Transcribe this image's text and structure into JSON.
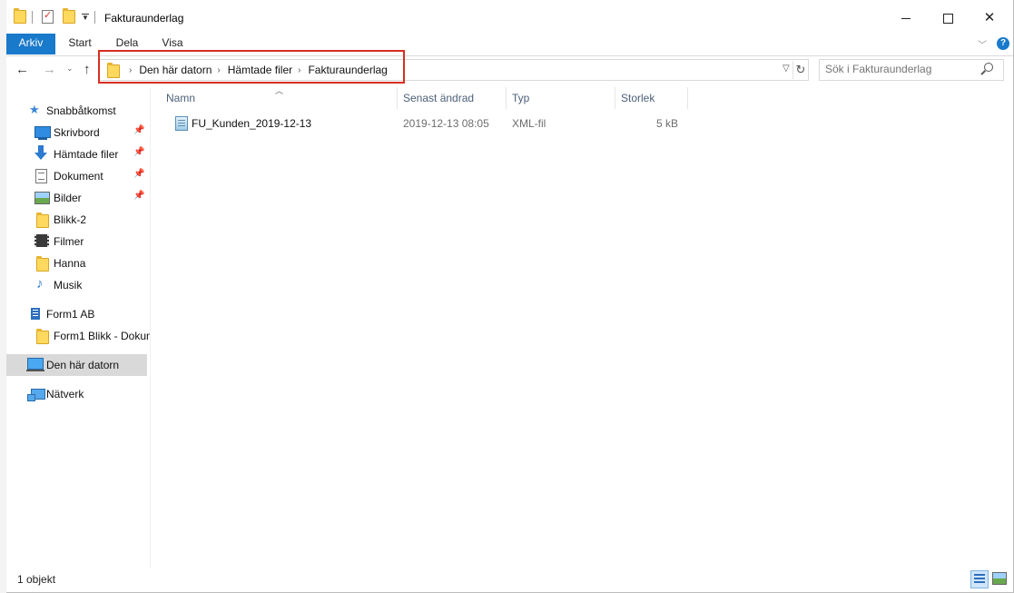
{
  "window": {
    "title": "Fakturaunderlag",
    "controls": {
      "minimize": "minimize-icon",
      "maximize": "maximize-icon",
      "close": "close-icon"
    }
  },
  "ribbon": {
    "tabs": [
      {
        "label": "Arkiv",
        "active": true
      },
      {
        "label": "Start"
      },
      {
        "label": "Dela"
      },
      {
        "label": "Visa"
      }
    ],
    "accent_color": "#1979ca"
  },
  "address": {
    "crumbs": [
      "Den här datorn",
      "Hämtade filer",
      "Fakturaunderlag"
    ],
    "highlight_color": "#d62f22"
  },
  "search": {
    "placeholder": "Sök i Fakturaunderlag"
  },
  "sidebar": {
    "items": [
      {
        "label": "Snabbåtkomst",
        "icon": "star-icon"
      },
      {
        "label": "Skrivbord",
        "icon": "desktop-icon",
        "pinned": true
      },
      {
        "label": "Hämtade filer",
        "icon": "download-icon",
        "pinned": true
      },
      {
        "label": "Dokument",
        "icon": "document-icon",
        "pinned": true
      },
      {
        "label": "Bilder",
        "icon": "pictures-icon",
        "pinned": true
      },
      {
        "label": "Blikk-2",
        "icon": "folder-icon"
      },
      {
        "label": "Filmer",
        "icon": "film-icon"
      },
      {
        "label": "Hanna",
        "icon": "folder-icon"
      },
      {
        "label": "Musik",
        "icon": "music-icon"
      },
      {
        "label": "Form1 AB",
        "icon": "building-icon"
      },
      {
        "label": "Form1 Blikk - Dokum",
        "icon": "folder-icon"
      },
      {
        "label": "Den här datorn",
        "icon": "computer-icon",
        "selected": true
      },
      {
        "label": "Nätverk",
        "icon": "network-icon"
      }
    ]
  },
  "filelist": {
    "columns": [
      "Namn",
      "Senast ändrad",
      "Typ",
      "Storlek"
    ],
    "rows": [
      {
        "name": "FU_Kunden_2019-12-13",
        "modified": "2019-12-13 08:05",
        "type": "XML-fil",
        "size": "5 kB",
        "icon": "xml-file-icon"
      }
    ]
  },
  "status": {
    "count": "1 objekt"
  }
}
